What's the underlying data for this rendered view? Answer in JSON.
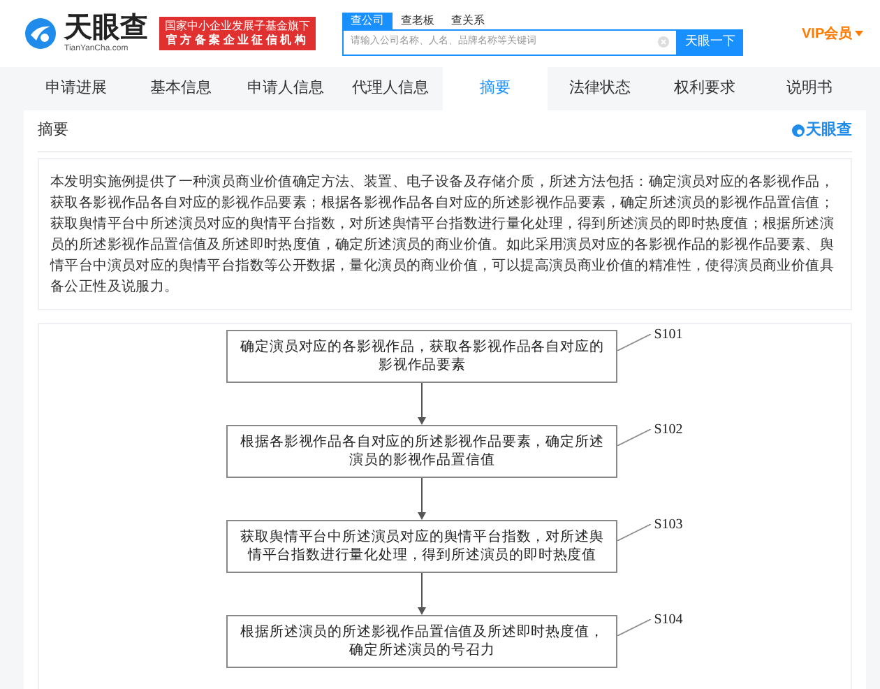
{
  "header": {
    "logo_name": "天眼查",
    "logo_domain": "TianYanCha.com",
    "badge_lines": [
      "国家中小企业发展子基金旗下",
      "官方备案企业征信机构"
    ],
    "search_tabs": [
      {
        "label": "查公司",
        "selected": true
      },
      {
        "label": "查老板",
        "selected": false
      },
      {
        "label": "查关系",
        "selected": false
      }
    ],
    "search": {
      "placeholder": "请输入公司名称、人名、品牌名称等关键词"
    },
    "search_button": "天眼一下",
    "vip": "VIP会员"
  },
  "tabs": [
    {
      "label": "申请进展",
      "selected": false
    },
    {
      "label": "基本信息",
      "selected": false
    },
    {
      "label": "申请人信息",
      "selected": false
    },
    {
      "label": "代理人信息",
      "selected": false
    },
    {
      "label": "摘要",
      "selected": true
    },
    {
      "label": "法律状态",
      "selected": false
    },
    {
      "label": "权利要求",
      "selected": false
    },
    {
      "label": "说明书",
      "selected": false
    }
  ],
  "section": {
    "title": "摘要",
    "brand": "天眼查"
  },
  "abstract": "本发明实施例提供了一种演员商业价值确定方法、装置、电子设备及存储介质，所述方法包括：确定演员对应的各影视作品，获取各影视作品各自对应的影视作品要素；根据各影视作品各自对应的所述影视作品要素，确定所述演员的影视作品置信值；获取舆情平台中所述演员对应的舆情平台指数，对所述舆情平台指数进行量化处理，得到所述演员的即时热度值；根据所述演员的所述影视作品置信值及所述即时热度值，确定所述演员的商业价值。如此采用演员对应的各影视作品的影视作品要素、舆情平台中演员对应的舆情平台指数等公开数据，量化演员的商业价值，可以提高演员商业价值的精准性，使得演员商业价值具备公正性及说服力。",
  "figure": {
    "steps": [
      {
        "text": "确定演员对应的各影视作品，获取各影视作品各自对应的影视作品要素",
        "label": "S101"
      },
      {
        "text": "根据各影视作品各自对应的所述影视作品要素，确定所述演员的影视作品置信值",
        "label": "S102"
      },
      {
        "text": "获取舆情平台中所述演员对应的舆情平台指数，对所述舆情平台指数进行量化处理，得到所述演员的即时热度值",
        "label": "S103"
      },
      {
        "text": "根据所述演员的所述影视作品置信值及所述即时热度值，确定所述演员的号召力",
        "label": "S104"
      }
    ]
  }
}
